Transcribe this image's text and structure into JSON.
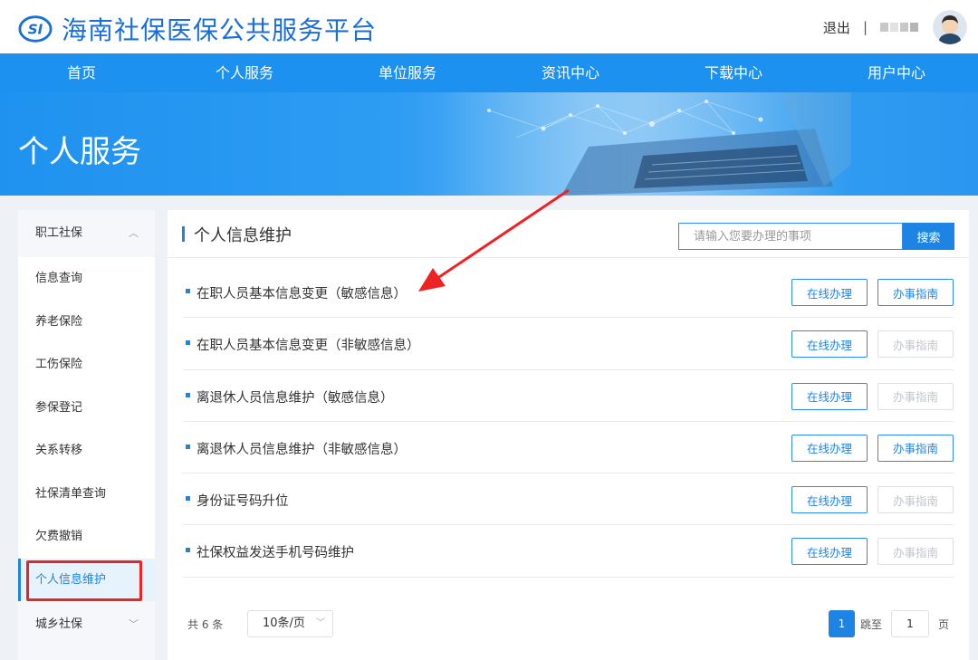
{
  "header": {
    "site_title": "海南社保医保公共服务平台",
    "logout": "退出",
    "separator": "|"
  },
  "nav": {
    "items": [
      {
        "label": "首页"
      },
      {
        "label": "个人服务"
      },
      {
        "label": "单位服务"
      },
      {
        "label": "资讯中心"
      },
      {
        "label": "下载中心"
      },
      {
        "label": "用户中心"
      }
    ]
  },
  "banner": {
    "title": "个人服务"
  },
  "sidebar": {
    "group_top": {
      "label": "职工社保",
      "icon": "chevron-up-icon"
    },
    "items": [
      {
        "label": "信息查询"
      },
      {
        "label": "养老保险"
      },
      {
        "label": "工伤保险"
      },
      {
        "label": "参保登记"
      },
      {
        "label": "关系转移"
      },
      {
        "label": "社保清单查询"
      },
      {
        "label": "欠费撤销"
      },
      {
        "label": "个人信息维护",
        "active": true
      }
    ],
    "group_bottom": {
      "label": "城乡社保",
      "icon": "chevron-down-icon"
    }
  },
  "main": {
    "title": "个人信息维护",
    "search": {
      "placeholder": "请输入您要办理的事项",
      "button": "搜索"
    },
    "rows": [
      {
        "title": "在职人员基本信息变更（敏感信息）",
        "online": "在线办理",
        "guide": "办事指南",
        "guide_enabled": true
      },
      {
        "title": "在职人员基本信息变更（非敏感信息）",
        "online": "在线办理",
        "guide": "办事指南",
        "guide_enabled": false
      },
      {
        "title": "离退休人员信息维护（敏感信息）",
        "online": "在线办理",
        "guide": "办事指南",
        "guide_enabled": false
      },
      {
        "title": "离退休人员信息维护（非敏感信息）",
        "online": "在线办理",
        "guide": "办事指南",
        "guide_enabled": true
      },
      {
        "title": "身份证号码升位",
        "online": "在线办理",
        "guide": "办事指南",
        "guide_enabled": false
      },
      {
        "title": "社保权益发送手机号码维护",
        "online": "在线办理",
        "guide": "办事指南",
        "guide_enabled": false
      }
    ]
  },
  "pager": {
    "total": "共 6 条",
    "page_size": "10条/页",
    "current_page": "1",
    "jump_label": "跳至",
    "jump_value": "1",
    "page_unit": "页"
  },
  "colors": {
    "brand_blue": "#1d84e4",
    "nav_blue": "#1d91f0",
    "annotation_red": "#ee2222"
  }
}
